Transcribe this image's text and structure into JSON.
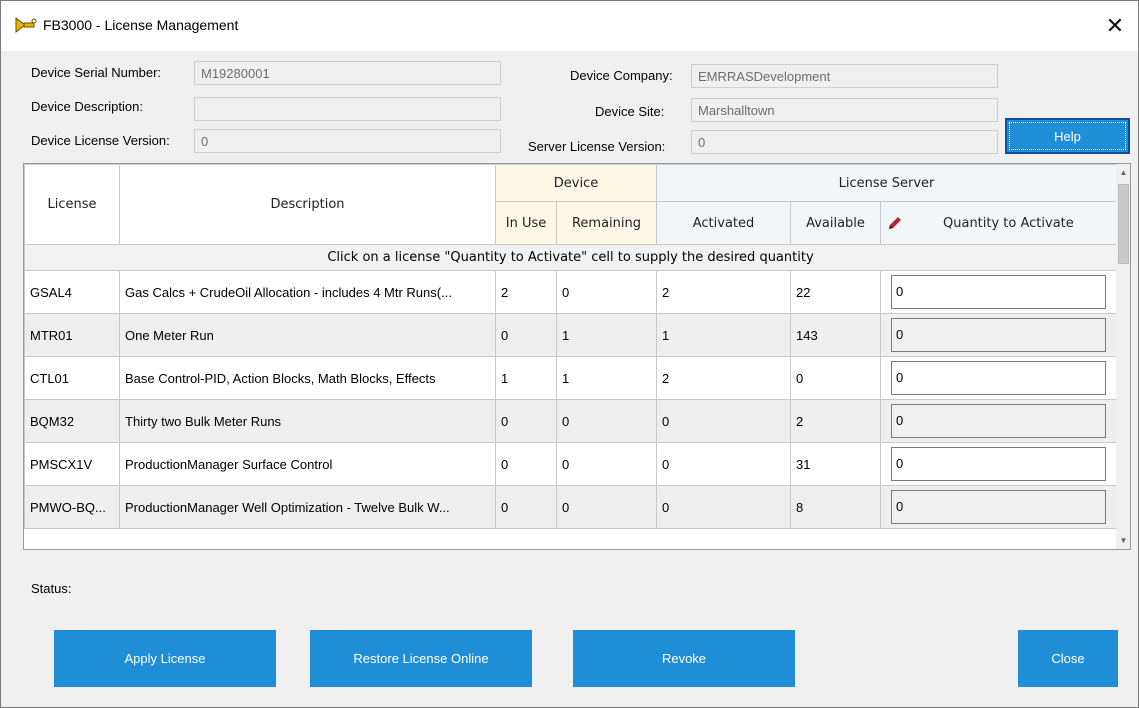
{
  "window": {
    "title": "FB3000 - License Management"
  },
  "device": {
    "serial_label": "Device Serial Number:",
    "serial_value": "M19280001",
    "description_label": "Device Description:",
    "description_value": "",
    "license_version_label": "Device License Version:",
    "license_version_value": "0",
    "company_label": "Device Company:",
    "company_value": "EMRRASDevelopment",
    "site_label": "Device Site:",
    "site_value": "Marshalltown",
    "server_version_label": "Server License Version:",
    "server_version_value": "0"
  },
  "help_label": "Help",
  "table": {
    "col_license": "License",
    "col_description": "Description",
    "group_device": "Device",
    "group_server": "License Server",
    "col_in_use": "In Use",
    "col_remaining": "Remaining",
    "col_activated": "Activated",
    "col_available": "Available",
    "col_quantity": "Quantity to Activate",
    "banner": "Click on a license \"Quantity to Activate\" cell to supply the desired quantity",
    "rows": [
      {
        "license": "GSAL4",
        "description": "Gas Calcs + CrudeOil Allocation - includes 4 Mtr Runs(...",
        "in_use": "2",
        "remaining": "0",
        "activated": "2",
        "available": "22",
        "quantity": "0"
      },
      {
        "license": "MTR01",
        "description": "One Meter Run",
        "in_use": "0",
        "remaining": "1",
        "activated": "1",
        "available": "143",
        "quantity": "0"
      },
      {
        "license": "CTL01",
        "description": "Base Control-PID, Action Blocks, Math Blocks, Effects",
        "in_use": "1",
        "remaining": "1",
        "activated": "2",
        "available": "0",
        "quantity": "0"
      },
      {
        "license": "BQM32",
        "description": "Thirty two Bulk Meter Runs",
        "in_use": "0",
        "remaining": "0",
        "activated": "0",
        "available": "2",
        "quantity": "0"
      },
      {
        "license": "PMSCX1V",
        "description": "ProductionManager Surface Control",
        "in_use": "0",
        "remaining": "0",
        "activated": "0",
        "available": "31",
        "quantity": "0"
      },
      {
        "license": "PMWO-BQ...",
        "description": "ProductionManager Well Optimization - Twelve Bulk W...",
        "in_use": "0",
        "remaining": "0",
        "activated": "0",
        "available": "8",
        "quantity": "0"
      }
    ]
  },
  "status_label": "Status:",
  "buttons": {
    "apply": "Apply License",
    "restore": "Restore License Online",
    "revoke": "Revoke",
    "close": "Close"
  },
  "colors": {
    "button_blue": "#1f8ed6",
    "help_border": "#0b4f9c"
  },
  "icons": [
    "app-icon",
    "close-icon",
    "pencil-icon",
    "scroll-up-icon",
    "scroll-down-icon"
  ]
}
